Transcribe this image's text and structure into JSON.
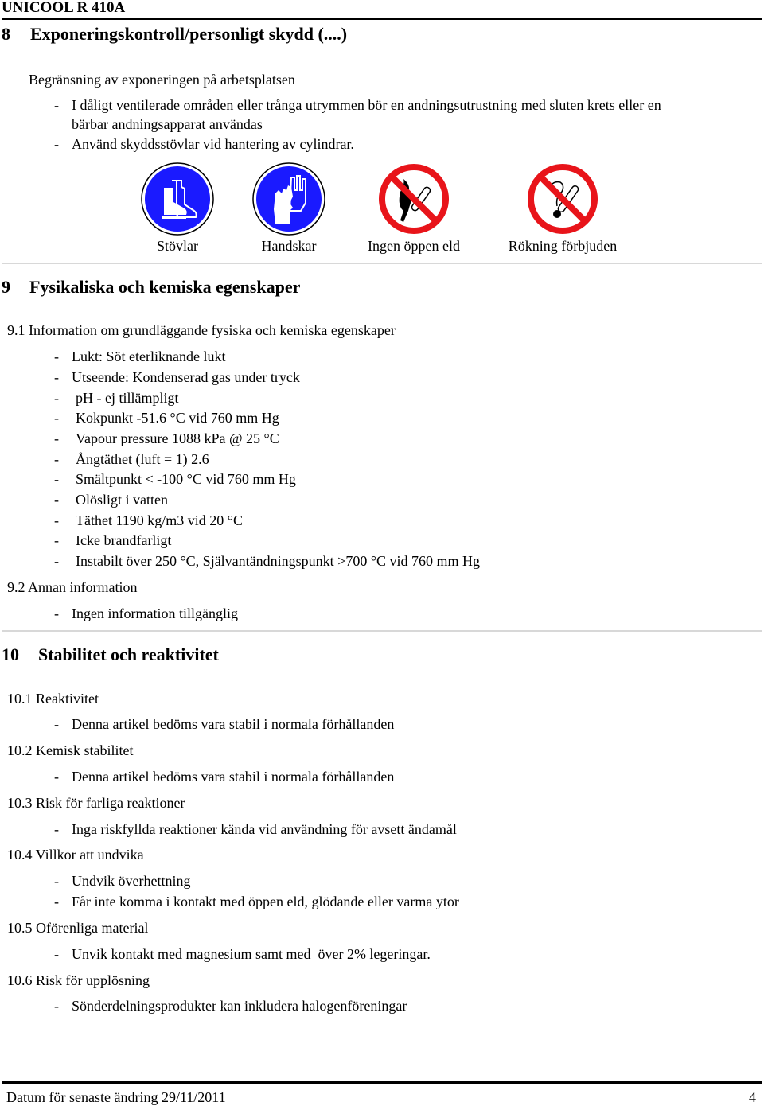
{
  "header": {
    "doc_title": "UNICOOL R 410A"
  },
  "section8": {
    "number": "8",
    "title": "Exponeringskontroll/personligt skydd (....)",
    "subheading": "Begränsning av exponeringen på arbetsplatsen",
    "bullets": [
      "I dåligt ventilerade områden eller trånga utrymmen bör en andningsutrustning med sluten krets eller en",
      "bärbar andningsapparat användas",
      "Använd skyddsstövlar vid hantering av cylindrar."
    ],
    "signs": [
      {
        "icon": "boots-icon",
        "label": "Stövlar",
        "color": "#1a1aff"
      },
      {
        "icon": "gloves-icon",
        "label": "Handskar",
        "color": "#1a1aff"
      },
      {
        "icon": "no-open-flame-icon",
        "label": "Ingen öppen eld",
        "color": "#e8141a"
      },
      {
        "icon": "no-smoking-icon",
        "label": "Rökning förbjuden",
        "color": "#e8141a"
      }
    ]
  },
  "section9": {
    "number": "9",
    "title": "Fysikaliska och kemiska egenskaper",
    "sub1": {
      "title": "9.1 Information om grundläggande fysiska och kemiska egenskaper",
      "items": [
        "Lukt: Söt eterliknande lukt",
        "Utseende: Kondenserad gas under tryck",
        "pH - ej tillämpligt",
        "Kokpunkt -51.6 °C vid 760 mm Hg",
        "Vapour pressure 1088 kPa @ 25 °C",
        "Ångtäthet (luft = 1) 2.6",
        "Smältpunkt < -100 °C vid 760 mm Hg",
        "Olösligt i vatten",
        "Täthet 1190 kg/m3 vid 20 °C",
        "Icke brandfarligt",
        "Instabilt över 250 °C, Självantändningspunkt >700 °C vid 760 mm Hg"
      ]
    },
    "sub2": {
      "title": "9.2 Annan information",
      "items": [
        "Ingen information tillgänglig"
      ]
    }
  },
  "section10": {
    "number": "10",
    "title": "Stabilitet och reaktivitet",
    "subs": [
      {
        "title": "10.1 Reaktivitet",
        "items": [
          "Denna artikel bedöms vara stabil i normala förhållanden"
        ]
      },
      {
        "title": "10.2 Kemisk stabilitet",
        "items": [
          "Denna artikel bedöms vara stabil i normala förhållanden"
        ]
      },
      {
        "title": "10.3 Risk för farliga reaktioner",
        "items": [
          "Inga riskfyllda reaktioner kända vid användning för avsett ändamål"
        ]
      },
      {
        "title": "10.4 Villkor att undvika",
        "items": [
          "Undvik överhettning",
          "Får inte komma i kontakt med öppen eld, glödande eller varma ytor"
        ]
      },
      {
        "title": "10.5 Oförenliga material",
        "items": [
          "Unvik kontakt med magnesium samt med  över 2% legeringar."
        ]
      },
      {
        "title": "10.6 Risk för upplösning",
        "items": [
          "Sönderdelningsprodukter kan inkludera halogenföreningar"
        ]
      }
    ]
  },
  "footer": {
    "date_label": "Datum för senaste ändring 29/11/2011",
    "page_number": "4"
  }
}
